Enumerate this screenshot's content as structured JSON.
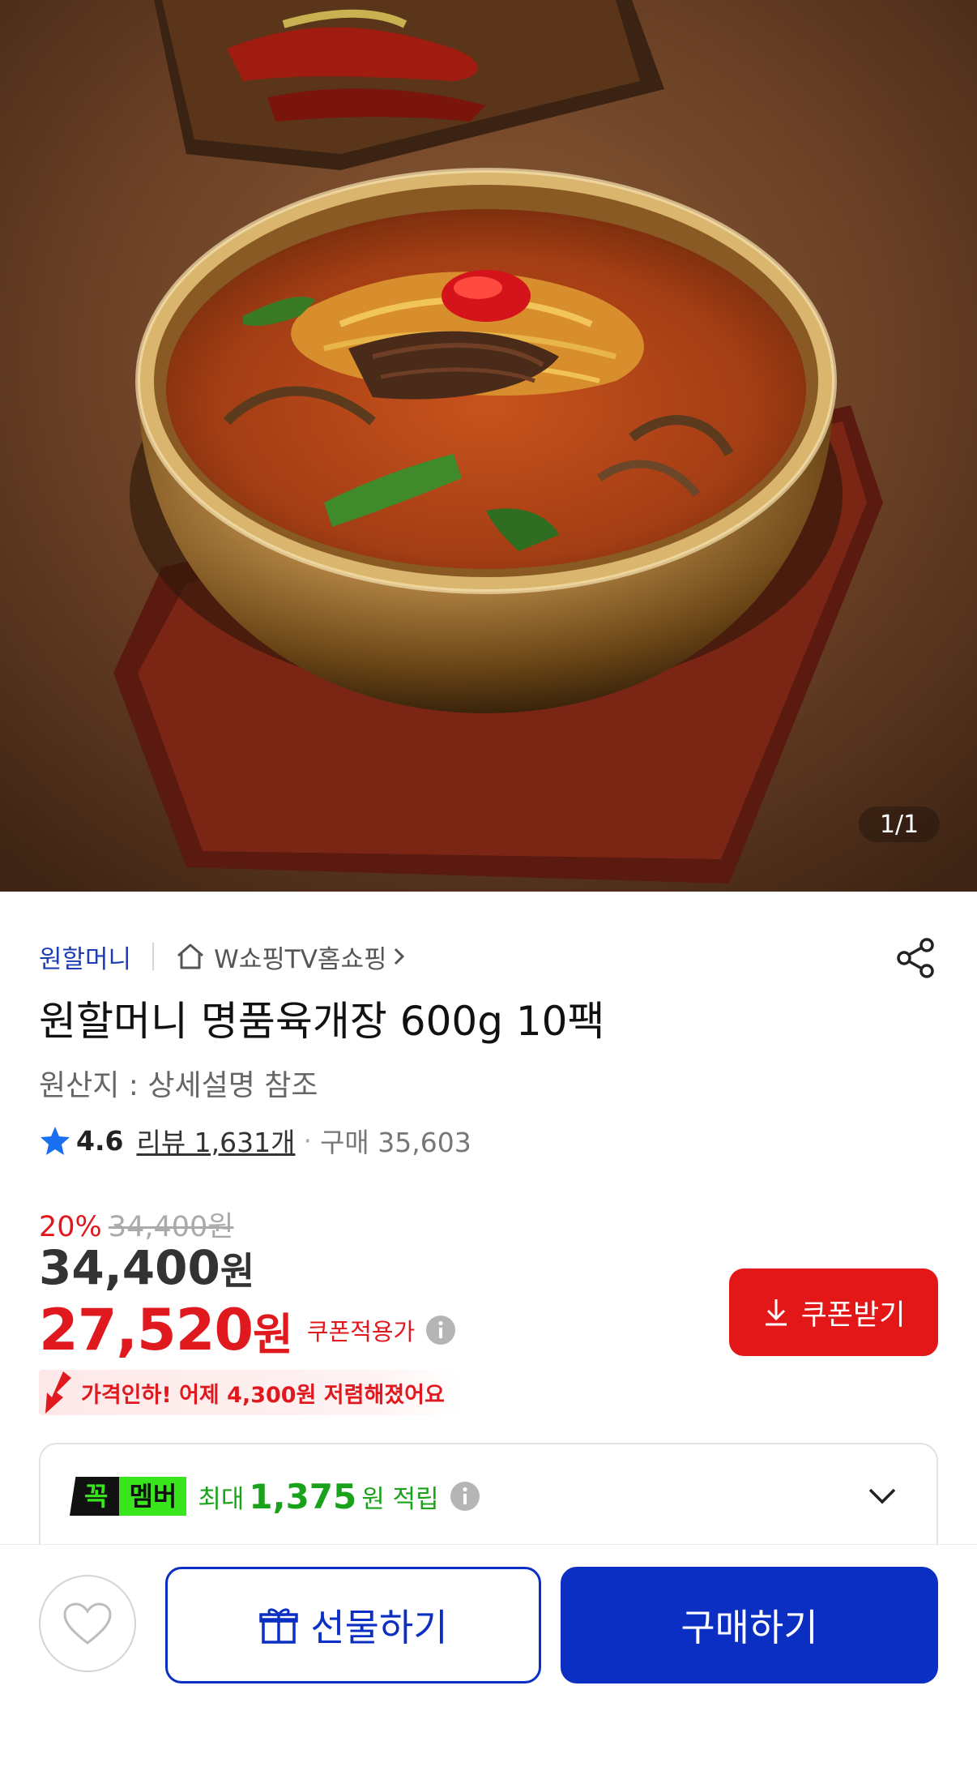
{
  "gallery": {
    "indicator": "1/1"
  },
  "seller": {
    "brand": "원할머니",
    "store": "W쇼핑TV홈쇼핑"
  },
  "product": {
    "title": "원할머니 명품육개장 600g 10팩",
    "origin": "원산지 : 상세설명 참조"
  },
  "rating": {
    "score": "4.6",
    "reviews": "리뷰 1,631개",
    "dot": "·",
    "purchases": "구매 35,603"
  },
  "pricing": {
    "discount_rate": "20%",
    "original_price": "34,400원",
    "price_number": "34,400",
    "price_unit": "원",
    "coupon_price_number": "27,520",
    "coupon_price_unit": "원",
    "coupon_label": "쿠폰적용가",
    "coupon_button": "쿠폰받기",
    "drop_notice": "가격인하! 어제 4,300원 저렴해졌어요"
  },
  "membership": {
    "badge_part1": "꼭",
    "badge_part2": "멤버",
    "prefix": "최대",
    "amount": "1,375",
    "suffix": "원 적립"
  },
  "actions": {
    "gift": "선물하기",
    "buy": "구매하기"
  },
  "colors": {
    "accent_blue": "#0a2fc2",
    "price_red": "#e0191f",
    "member_green": "#39e61e"
  }
}
